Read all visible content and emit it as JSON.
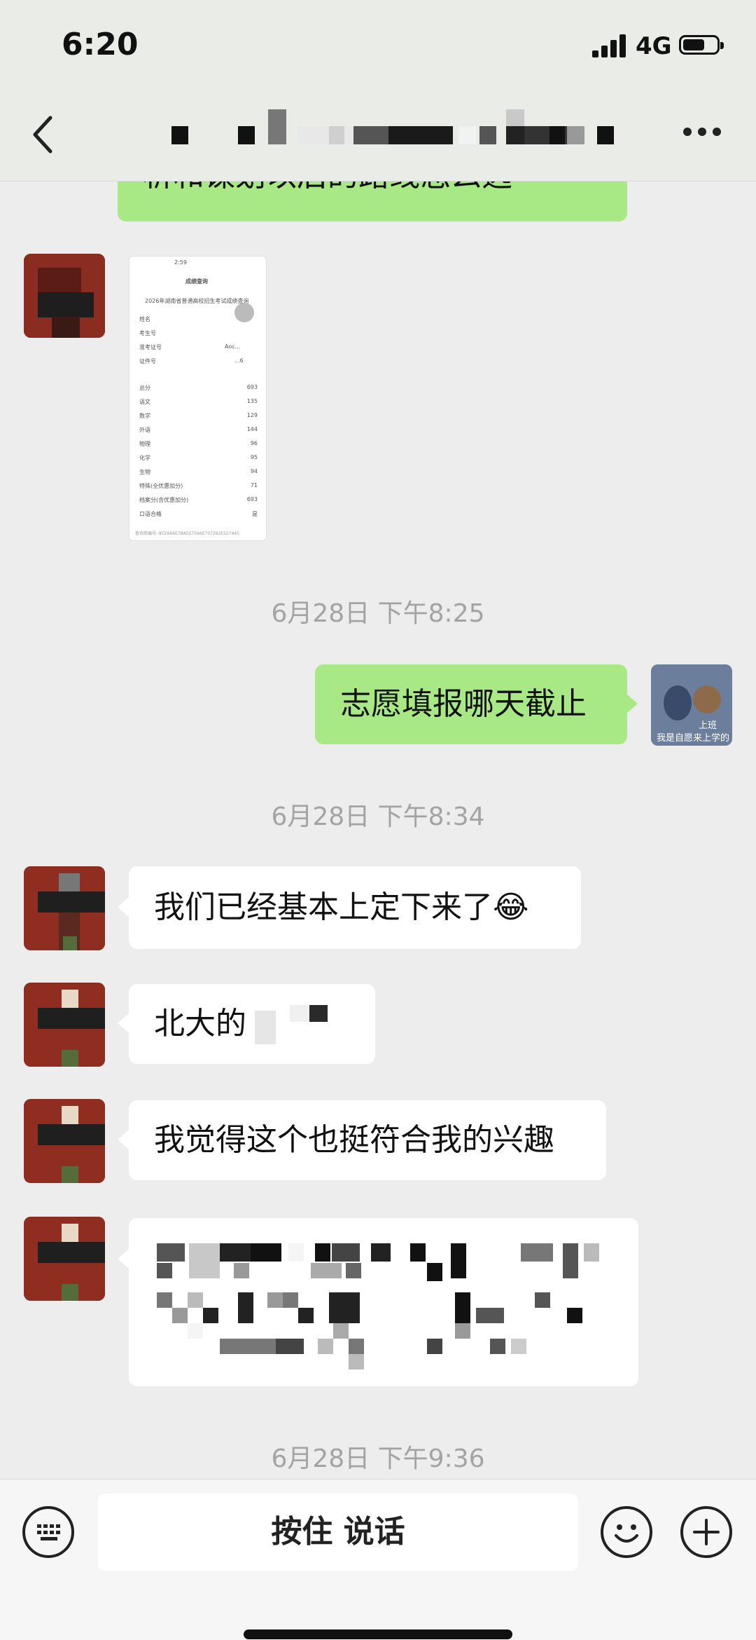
{
  "status_bar": {
    "time": "6:20",
    "network": "4G"
  },
  "header": {
    "title_hidden": true
  },
  "messages": {
    "partial_top_text": "析和谋划以后的路线怎么选",
    "timestamp_1": "6月28日 下午8:25",
    "outgoing_1": "志愿填报哪天截止",
    "self_avatar_caption": "我是自愿来上学的",
    "self_avatar_tag": "上班",
    "timestamp_2": "6月28日 下午8:34",
    "incoming_1": "我们已经基本上定下来了",
    "incoming_1_emoji": "😂",
    "incoming_2": "北大的",
    "incoming_3": "我觉得这个也挺符合我的兴趣",
    "timestamp_3": "6月28日 下午9:36"
  },
  "score_screenshot": {
    "status": "2:59",
    "header": "成绩查询",
    "subtitle": "2026年湖南省普通高校招生考试成绩查询",
    "fields": [
      "姓名",
      "考生号",
      "准考证号",
      "证件号"
    ],
    "field_values": [
      "",
      "",
      "Aoc...",
      "...6"
    ],
    "rows": [
      {
        "label": "总分",
        "value": "693"
      },
      {
        "label": "语文",
        "value": "135"
      },
      {
        "label": "数学",
        "value": "129"
      },
      {
        "label": "外语",
        "value": "144"
      },
      {
        "label": "物理",
        "value": "96"
      },
      {
        "label": "化学",
        "value": "95"
      },
      {
        "label": "生物",
        "value": "94"
      },
      {
        "label": "特殊(全优惠加分)",
        "value": "71"
      },
      {
        "label": "档案分(含优惠加分)",
        "value": "693"
      },
      {
        "label": "口语合格",
        "value": "是"
      }
    ],
    "footer": "查询单编号: 8CE666E78A557566E7072835527445"
  },
  "input_bar": {
    "voice_label": "按住 说话"
  },
  "colors": {
    "outgoing_bubble": "#a9e985",
    "incoming_bubble": "#ffffff",
    "background": "#ededed"
  }
}
